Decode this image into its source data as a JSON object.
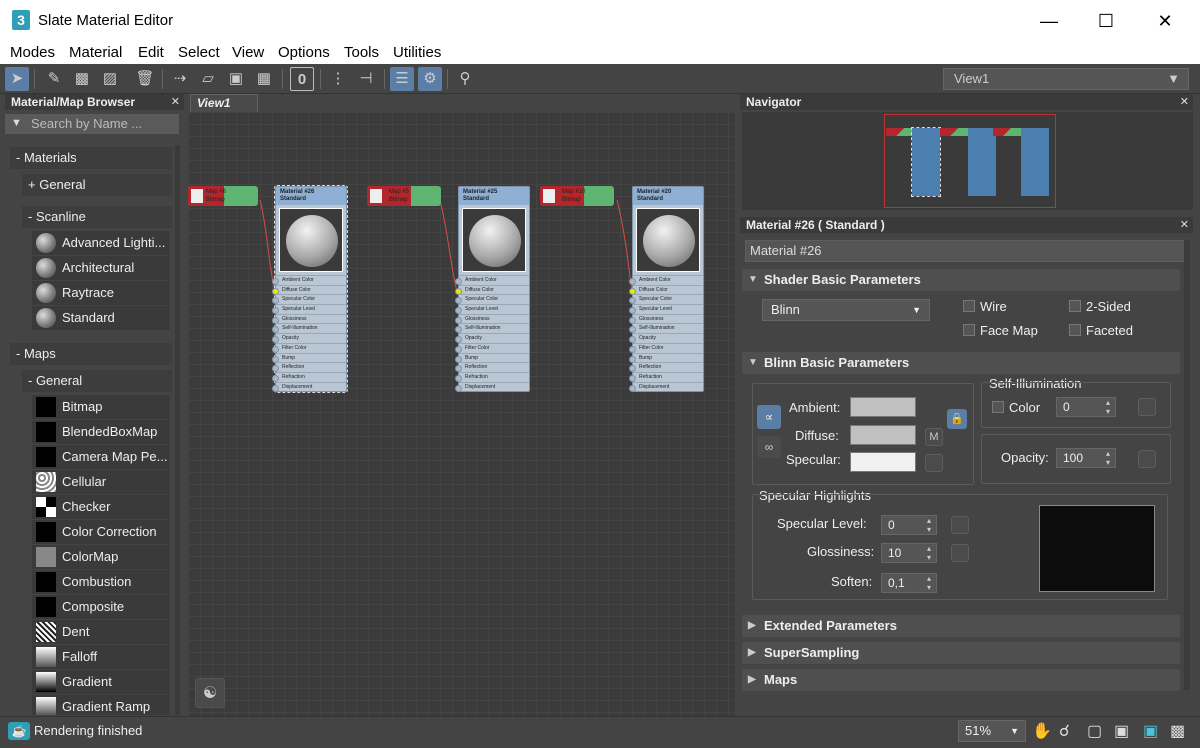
{
  "window": {
    "title": "Slate Material Editor",
    "app_icon": "3"
  },
  "menu": [
    "Modes",
    "Material",
    "Edit",
    "Select",
    "View",
    "Options",
    "Tools",
    "Utilities"
  ],
  "view_selector": {
    "value": "View1"
  },
  "toolbar": {
    "material_id_value": "0"
  },
  "browser": {
    "title": "Material/Map Browser",
    "search_placeholder": "Search by Name ...",
    "materials_group": "- Materials",
    "general_group": "+ General",
    "scanline_group": "- Scanline",
    "scanline_items": [
      "Advanced Lighti...",
      "Architectural",
      "Raytrace",
      "Standard"
    ],
    "maps_group": "- Maps",
    "maps_general_group": "- General",
    "map_items": [
      "Bitmap",
      "BlendedBoxMap",
      "Camera Map Pe...",
      "Cellular",
      "Checker",
      "Color Correction",
      "ColorMap",
      "Combustion",
      "Composite",
      "Dent",
      "Falloff",
      "Gradient",
      "Gradient Ramp"
    ]
  },
  "view": {
    "tab": "View1",
    "nodes": [
      {
        "name": "Material #26",
        "type": "Standard"
      },
      {
        "name": "Material #25",
        "type": "Standard"
      },
      {
        "name": "Material #20",
        "type": "Standard"
      }
    ],
    "map_nodes": [
      {
        "name": "Map #6",
        "type": "Bitmap"
      },
      {
        "name": "Map #5",
        "type": "Bitmap"
      },
      {
        "name": "Map #10",
        "type": "Bitmap"
      }
    ],
    "slots": [
      "Ambient Color",
      "Diffuse Color",
      "Specular Color",
      "Specular Level",
      "Glossiness",
      "Self-Illumination",
      "Opacity",
      "Filter Color",
      "Bump",
      "Reflection",
      "Refraction",
      "Displacement"
    ]
  },
  "navigator": {
    "title": "Navigator"
  },
  "params": {
    "header": "Material #26  ( Standard )",
    "name_value": "Material #26",
    "shader_rollout": "Shader Basic Parameters",
    "shader_value": "Blinn",
    "wire": "Wire",
    "two_sided": "2-Sided",
    "face_map": "Face Map",
    "faceted": "Faceted",
    "blinn_rollout": "Blinn Basic Parameters",
    "self_illum_title": "Self-Illumination",
    "self_illum_color": "Color",
    "self_illum_value": "0",
    "ambient": "Ambient:",
    "diffuse": "Diffuse:",
    "specular": "Specular:",
    "m_button": "M",
    "opacity_label": "Opacity:",
    "opacity_value": "100",
    "spec_highlights": "Specular Highlights",
    "spec_level_label": "Specular Level:",
    "spec_level_value": "0",
    "glossiness_label": "Glossiness:",
    "glossiness_value": "10",
    "soften_label": "Soften:",
    "soften_value": "0,1",
    "extended_rollout": "Extended Parameters",
    "supersampling_rollout": "SuperSampling",
    "maps_rollout": "Maps",
    "colors": {
      "ambient": "#c0c0c0",
      "diffuse": "#c0c0c0",
      "specular": "#f0f0f0"
    }
  },
  "status": {
    "text": "Rendering finished",
    "zoom": "51%"
  }
}
